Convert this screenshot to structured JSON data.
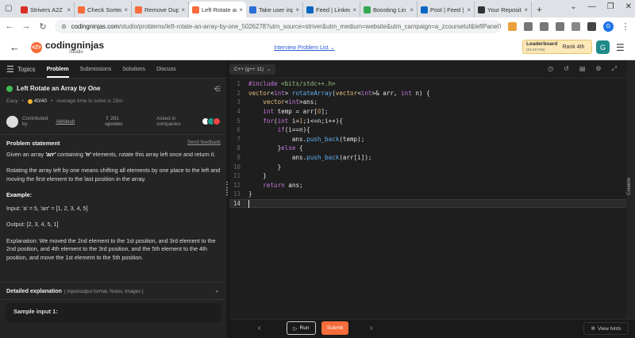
{
  "browser": {
    "tabs": [
      {
        "title": "Strivers A2Z D",
        "color": "#d93025"
      },
      {
        "title": "Check Sorted",
        "color": "#f66c3b"
      },
      {
        "title": "Remove Dupl",
        "color": "#f66c3b"
      },
      {
        "title": "Left Rotate an",
        "color": "#f66c3b"
      },
      {
        "title": "Take user inp",
        "color": "#2b6fd6"
      },
      {
        "title": "Feed | Linked",
        "color": "#0a66c2"
      },
      {
        "title": "Boosting Lin",
        "color": "#34a853"
      },
      {
        "title": "Post | Feed |",
        "color": "#0a66c2"
      },
      {
        "title": "Your Reposit",
        "color": "#333333"
      }
    ],
    "url_host": "codingninjas.com",
    "url_path": "/studio/problems/left-rotate-an-array-by-one_5026278?utm_source=striver&utm_medium=website&utm_campaign=a_zcoursetuf&leftPanelTabValue=...",
    "profile_initial": "G"
  },
  "site": {
    "brand": "codingninjas",
    "brand_sub": "/studio",
    "problem_list": "Interview Problem List",
    "leaderboard": "Leaderboard",
    "leaderboard_dates": "(19-25 Feb)",
    "rank": "Rank 4th",
    "user_initial": "G"
  },
  "left": {
    "topics": "Topics",
    "tabs": [
      "Problem",
      "Submissions",
      "Solutions",
      "Discuss"
    ],
    "title": "Left Rotate an Array by One",
    "difficulty": "Easy",
    "points": "40/40",
    "avg_time": "Average time to solve is 25m",
    "contributed_by": "Contributed by",
    "author": "Akhilesh",
    "upvotes": "201 upvotes",
    "asked_in": "Asked in companies",
    "statement_heading": "Problem statement",
    "send_feedback": "Send feedback",
    "p1_a": "Given an array ",
    "p1_arr": "'arr'",
    "p1_b": " containing ",
    "p1_n": "'n'",
    "p1_c": " elements, rotate this array left once and return it.",
    "p2": "Rotating the array left by one means shifting all elements by one place to the left and moving the first element to the last position in the array.",
    "example_heading": "Example:",
    "input": "Input: 'a' = 5, 'arr' = [1, 2, 3, 4, 5]",
    "output": "Output: [2, 3, 4, 5, 1]",
    "explanation": "Explanation: We moved the 2nd element to the 1st position, and 3rd element to the 2nd position, and 4th element to the 3rd position, and the 5th element to the 4th position, and move the 1st element to the 5th position.",
    "detailed": "Detailed explanation",
    "detailed_sub": "( Input/output format, Notes, Images )",
    "sample": "Sample input 1:"
  },
  "editor": {
    "language": "C++ (g++ 11)",
    "console": "Console"
  },
  "bottom": {
    "run": "Run",
    "submit": "Submit",
    "hints": "View hints"
  }
}
